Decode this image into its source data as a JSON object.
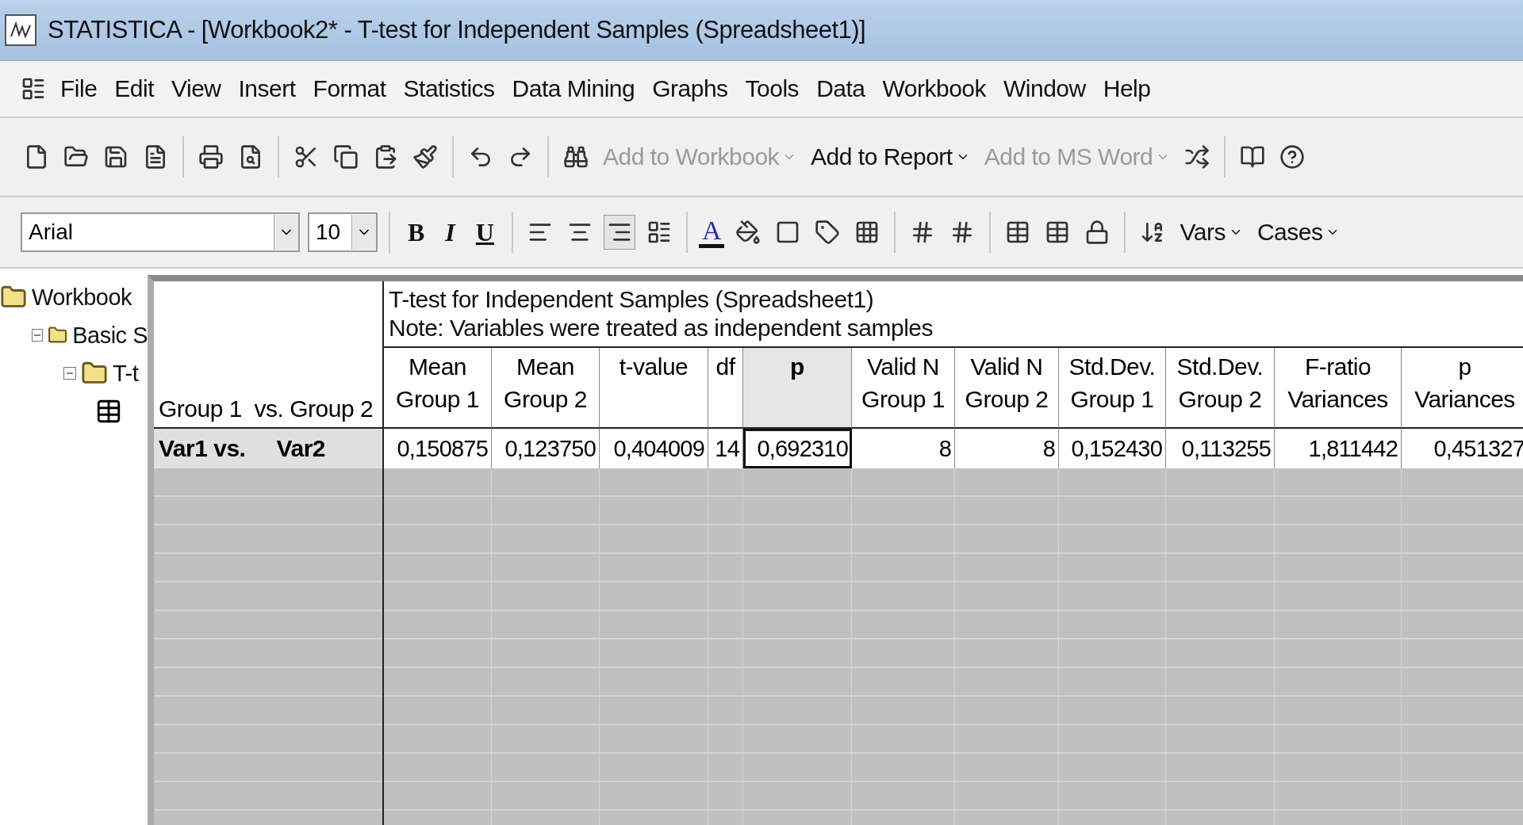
{
  "window": {
    "title": "STATISTICA - [Workbook2* - T-test for Independent Samples (Spreadsheet1)]"
  },
  "menu": [
    {
      "label": "File"
    },
    {
      "label": "Edit"
    },
    {
      "label": "View"
    },
    {
      "label": "Insert"
    },
    {
      "label": "Format"
    },
    {
      "label": "Statistics"
    },
    {
      "label": "Data Mining"
    },
    {
      "label": "Graphs"
    },
    {
      "label": "Tools"
    },
    {
      "label": "Data"
    },
    {
      "label": "Workbook"
    },
    {
      "label": "Window"
    },
    {
      "label": "Help"
    }
  ],
  "output_buttons": [
    {
      "label": "Add to Workbook",
      "disabled": true
    },
    {
      "label": "Add to Report",
      "disabled": false
    },
    {
      "label": "Add to MS Word",
      "disabled": true
    }
  ],
  "format_bar": {
    "font": "Arial",
    "size": "10",
    "bold": "B",
    "italic": "I",
    "underline": "U",
    "font_color": "A",
    "vars": "Vars",
    "cases": "Cases",
    "alignments": [
      {
        "selected": false
      },
      {
        "selected": false
      },
      {
        "selected": true
      }
    ]
  },
  "tree": [
    {
      "label": "Workbook",
      "children": [
        {
          "label": "Basic S",
          "expanded": true,
          "children": [
            {
              "label": "T-t",
              "expanded": true,
              "children": [
                {
                  "kind": "spreadsheet"
                }
              ]
            }
          ]
        }
      ]
    }
  ],
  "sheet": {
    "title": "T-test for Independent Samples (Spreadsheet1)",
    "note": "Note: Variables were treated as independent samples",
    "corner": "Group 1  vs. Group 2",
    "columns": [
      {
        "line1": "Mean",
        "line2": "Group 1",
        "selected": false
      },
      {
        "line1": "Mean",
        "line2": "Group 2",
        "selected": false
      },
      {
        "line1": "t-value",
        "selected": false
      },
      {
        "line1": "df",
        "selected": false
      },
      {
        "line1": "p",
        "selected": true
      },
      {
        "line1": "Valid N",
        "line2": "Group 1",
        "selected": false
      },
      {
        "line1": "Valid N",
        "line2": "Group 2",
        "selected": false
      },
      {
        "line1": "Std.Dev.",
        "line2": "Group 1",
        "selected": false
      },
      {
        "line1": "Std.Dev.",
        "line2": "Group 2",
        "selected": false
      },
      {
        "line1": "F-ratio",
        "line2": "Variances",
        "selected": false
      },
      {
        "line1": "p",
        "line2": "Variances",
        "selected": false
      }
    ],
    "rows": [
      {
        "label": "Var1 vs.     Var2",
        "cells": [
          {
            "value": "0,150875",
            "selected": false
          },
          {
            "value": "0,123750",
            "selected": false
          },
          {
            "value": "0,404009",
            "selected": false
          },
          {
            "value": "14",
            "selected": false
          },
          {
            "value": "0,692310",
            "selected": true
          },
          {
            "value": "8",
            "selected": false
          },
          {
            "value": "8",
            "selected": false
          },
          {
            "value": "0,152430",
            "selected": false
          },
          {
            "value": "0,113255",
            "selected": false
          },
          {
            "value": "1,811442",
            "selected": false
          },
          {
            "value": "0,451327",
            "selected": false
          }
        ]
      }
    ]
  }
}
